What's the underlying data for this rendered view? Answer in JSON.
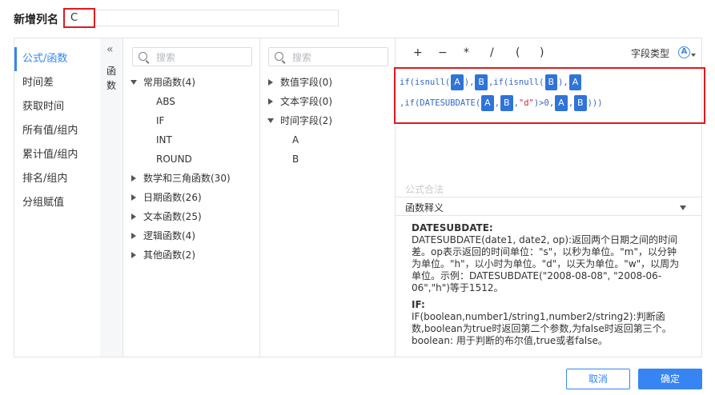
{
  "header": {
    "name_label": "新增列名",
    "name_value": "C"
  },
  "categories": [
    {
      "label": "公式/函数",
      "active": true
    },
    {
      "label": "时间差"
    },
    {
      "label": "获取时间"
    },
    {
      "label": "所有值/组内"
    },
    {
      "label": "累计值/组内"
    },
    {
      "label": "排名/组内"
    },
    {
      "label": "分组赋值"
    }
  ],
  "strip": {
    "label": "函数"
  },
  "functions": {
    "search_placeholder": "搜索",
    "groups": [
      {
        "label": "常用函数(4)",
        "expanded": true,
        "items": [
          "ABS",
          "IF",
          "INT",
          "ROUND"
        ]
      },
      {
        "label": "数学和三角函数(30)"
      },
      {
        "label": "日期函数(26)"
      },
      {
        "label": "文本函数(25)"
      },
      {
        "label": "逻辑函数(4)"
      },
      {
        "label": "其他函数(2)"
      }
    ]
  },
  "fields": {
    "search_placeholder": "搜索",
    "groups": [
      {
        "label": "数值字段(0)"
      },
      {
        "label": "文本字段(0)"
      },
      {
        "label": "时间字段(2)",
        "expanded": true,
        "items": [
          "A",
          "B"
        ]
      }
    ]
  },
  "toolbar": {
    "operators": [
      "+",
      "−",
      "*",
      "/",
      "(",
      ")"
    ],
    "field_type_label": "字段类型",
    "field_type_icon": "A"
  },
  "formula": {
    "line1": [
      {
        "t": "text",
        "v": "if(isnull("
      },
      {
        "t": "tag",
        "v": "A"
      },
      {
        "t": "text",
        "v": "),"
      },
      {
        "t": "tag",
        "v": "B"
      },
      {
        "t": "text",
        "v": ",if(isnull("
      },
      {
        "t": "tag",
        "v": "B"
      },
      {
        "t": "text",
        "v": "),"
      },
      {
        "t": "tag",
        "v": "A"
      }
    ],
    "line2": [
      {
        "t": "text",
        "v": ",if(DATESUBDATE("
      },
      {
        "t": "tag",
        "v": "A"
      },
      {
        "t": "text",
        "v": ","
      },
      {
        "t": "tag",
        "v": "B"
      },
      {
        "t": "text",
        "v": ","
      },
      {
        "t": "str",
        "v": "\"d\""
      },
      {
        "t": "text",
        "v": ")>0,"
      },
      {
        "t": "tag",
        "v": "A"
      },
      {
        "t": "text",
        "v": ","
      },
      {
        "t": "tag",
        "v": "B"
      },
      {
        "t": "text",
        "v": ")))"
      }
    ]
  },
  "status": {
    "valid_text": "公式合法"
  },
  "description": {
    "title": "函数释义",
    "h1": "DATESUBDATE:",
    "p1": "DATESUBDATE(date1, date2, op):返回两个日期之间的时间差。op表示返回的时间单位：\"s\"，以秒为单位。\"m\"，以分钟为单位。\"h\"，以小时为单位。\"d\"，以天为单位。\"w\"，以周为单位。示例：DATESUBDATE(\"2008-08-08\", \"2008-06-06\",\"h\")等于1512。",
    "h2": "IF:",
    "p2": "IF(boolean,number1/string1,number2/string2):判断函数,boolean为true时返回第二个参数,为false时返回第三个。boolean: 用于判断的布尔值,true或者false。"
  },
  "buttons": {
    "cancel": "取消",
    "ok": "确定"
  }
}
